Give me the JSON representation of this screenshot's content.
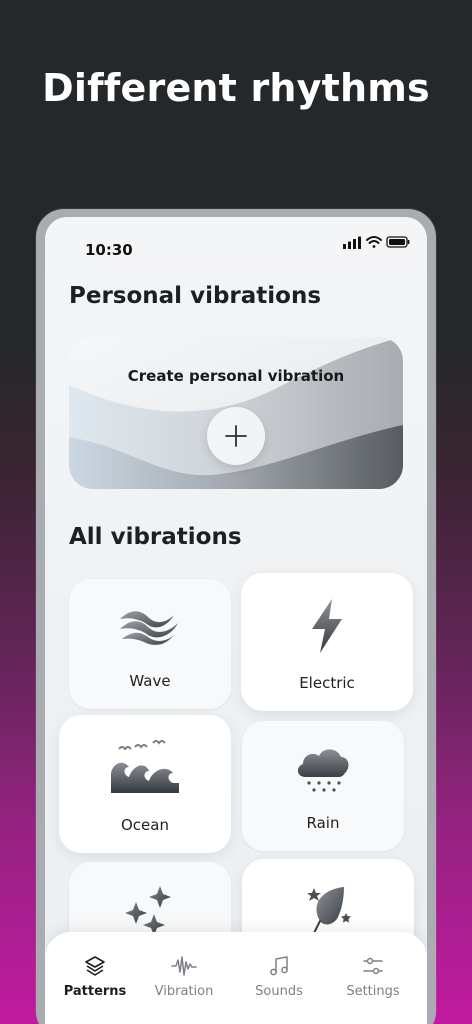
{
  "headline": "Different rhythms",
  "status": {
    "time": "10:30"
  },
  "personal": {
    "title": "Personal vibrations",
    "create_label": "Create personal vibration"
  },
  "all": {
    "title": "All vibrations",
    "items": [
      {
        "label": "Wave",
        "icon": "wave-icon"
      },
      {
        "label": "Electric",
        "icon": "lightning-icon"
      },
      {
        "label": "Ocean",
        "icon": "ocean-icon"
      },
      {
        "label": "Rain",
        "icon": "rain-cloud-icon"
      },
      {
        "label": "",
        "icon": "sparkles-icon"
      },
      {
        "label": "",
        "icon": "leaf-stars-icon"
      }
    ]
  },
  "tabs": [
    {
      "label": "Patterns",
      "icon": "layers-icon",
      "active": true
    },
    {
      "label": "Vibration",
      "icon": "waveform-icon",
      "active": false
    },
    {
      "label": "Sounds",
      "icon": "music-note-icon",
      "active": false
    },
    {
      "label": "Settings",
      "icon": "sliders-icon",
      "active": false
    }
  ],
  "colors": {
    "background_top": "#25282b",
    "background_bottom": "#c219a0",
    "screen": "#f4f5f7",
    "icon_gray": "#4a4f55"
  }
}
